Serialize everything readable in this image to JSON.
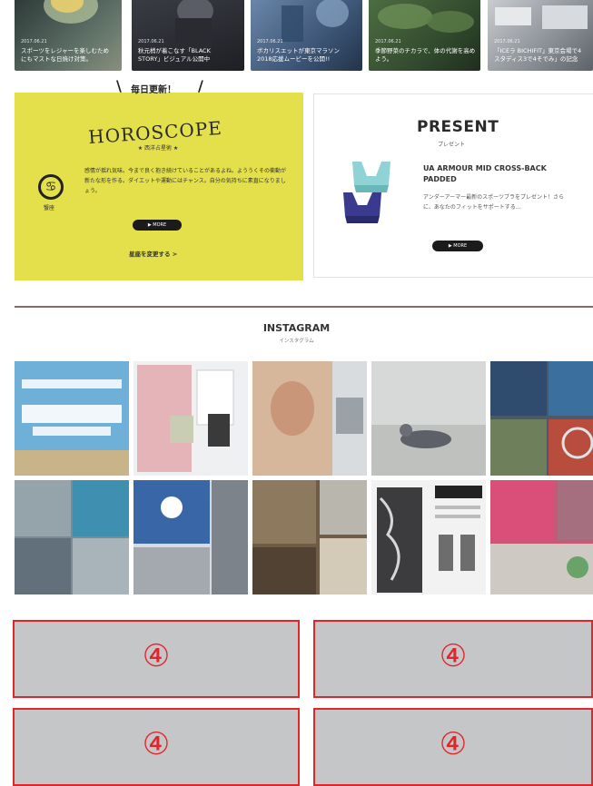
{
  "articles": [
    {
      "date": "2017.06.21",
      "title": "スポーツをレジャーを楽しむため\nにもマストな日焼け対策。",
      "bg": "#4a5a58"
    },
    {
      "date": "2017.06.21",
      "title": "秋元梢が着こなす「BLACK\nSTORY」ビジュアル公開中",
      "bg": "#2c2c30"
    },
    {
      "date": "2017.06.21",
      "title": "ボカリスエットが東京マラソン\n2018応援ムービーを公開!!",
      "bg": "#4d6a8a"
    },
    {
      "date": "2017.06.21",
      "title": "季節野菜のチカラで、体の代謝を高め\nよう。",
      "bg": "#3f5a3c"
    },
    {
      "date": "2017.06.21",
      "title": "「ICEラ BICHIFIT」東京会場で4\nスタディス3で4そでみ」の記念",
      "bg": "#8e9396"
    }
  ],
  "horoscope": {
    "tag": "毎日更新！",
    "title": "HOROSCOPE",
    "subtitle": "★ 西洋占星術 ★",
    "sign_symbol": "♋",
    "sign_name": "蟹座",
    "text": "感情が揺れ気味。今まで良く抱き続けていることがあるよね。よううくその衝動が新たな形を作る。ダイエットや運動にはチャンス。自分の気持ちに素直になりましょう。",
    "more": "▶ MORE",
    "change_sign": "星座を変更する >"
  },
  "present": {
    "title": "PRESENT",
    "subtitle": "プレゼント",
    "product": "UA ARMOUR MID CROSS-BACK PADDED",
    "description": "アンダーアーマー最新のスポーツブラをプレゼント！さらに、あなたのフィットをサポートする…",
    "more": "▶ MORE"
  },
  "instagram": {
    "title": "INSTAGRAM",
    "subtitle": "インスタグラム"
  },
  "ads": [
    "④",
    "④",
    "④",
    "④"
  ]
}
